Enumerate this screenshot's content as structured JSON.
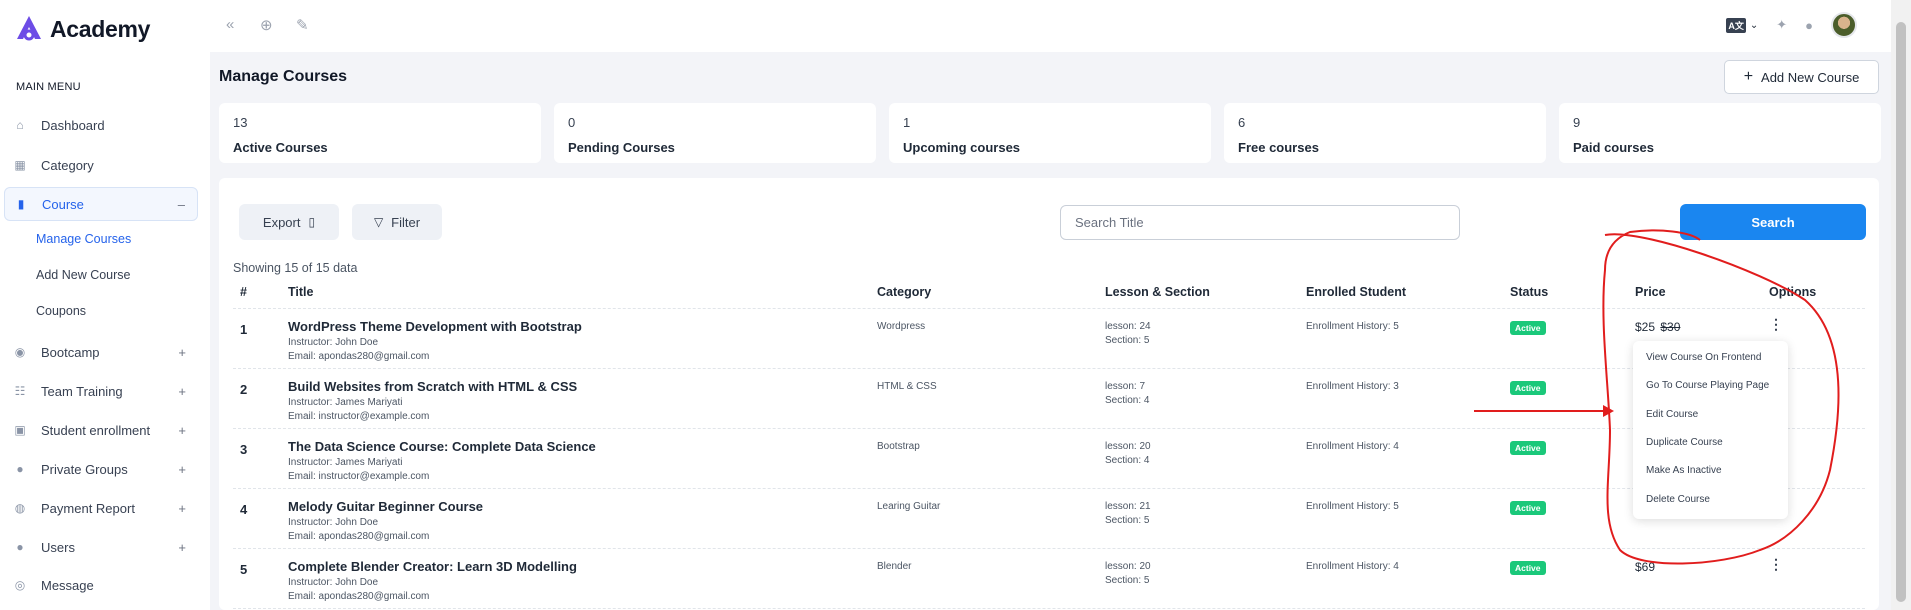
{
  "app": {
    "name": "Academy"
  },
  "sidebar": {
    "heading": "MAIN MENU",
    "items": [
      {
        "label": "Dashboard",
        "icon": "home-icon",
        "toggle": ""
      },
      {
        "label": "Category",
        "icon": "grid-icon",
        "toggle": ""
      },
      {
        "label": "Course",
        "icon": "book-icon",
        "toggle": "–"
      },
      {
        "label": "Bootcamp",
        "icon": "broadcast-icon",
        "toggle": "+"
      },
      {
        "label": "Team Training",
        "icon": "team-icon",
        "toggle": "+"
      },
      {
        "label": "Student enrollment",
        "icon": "id-card-icon",
        "toggle": "+"
      },
      {
        "label": "Private Groups",
        "icon": "group-icon",
        "toggle": "+"
      },
      {
        "label": "Payment Report",
        "icon": "payment-icon",
        "toggle": "+"
      },
      {
        "label": "Users",
        "icon": "users-icon",
        "toggle": "+"
      },
      {
        "label": "Message",
        "icon": "message-icon",
        "toggle": ""
      }
    ],
    "course_sub": [
      "Manage Courses",
      "Add New Course",
      "Coupons"
    ]
  },
  "header": {
    "page_title": "Manage Courses",
    "add_button": "Add New Course",
    "lang_label": "A文"
  },
  "stats": [
    {
      "value": "13",
      "label": "Active Courses"
    },
    {
      "value": "0",
      "label": "Pending Courses"
    },
    {
      "value": "1",
      "label": "Upcoming courses"
    },
    {
      "value": "6",
      "label": "Free courses"
    },
    {
      "value": "9",
      "label": "Paid courses"
    }
  ],
  "toolbar": {
    "export": "Export",
    "filter": "Filter",
    "search_placeholder": "Search Title",
    "search_button": "Search",
    "showing": "Showing 15 of 15 data"
  },
  "table": {
    "headers": [
      "#",
      "Title",
      "Category",
      "Lesson & Section",
      "Enrolled Student",
      "Status",
      "Price",
      "Options"
    ],
    "rows": [
      {
        "num": "1",
        "title": "WordPress Theme Development with Bootstrap",
        "instructor": "Instructor: John Doe",
        "email": "Email: apondas280@gmail.com",
        "category": "Wordpress",
        "lesson": "lesson: 24",
        "section": "Section: 5",
        "enrolled": "Enrollment History: 5",
        "status": "Active",
        "price": "$25",
        "old_price": "$30"
      },
      {
        "num": "2",
        "title": "Build Websites from Scratch with HTML & CSS",
        "instructor": "Instructor: James Mariyati",
        "email": "Email: instructor@example.com",
        "category": "HTML & CSS",
        "lesson": "lesson: 7",
        "section": "Section: 4",
        "enrolled": "Enrollment History: 3",
        "status": "Active",
        "price": "",
        "old_price": ""
      },
      {
        "num": "3",
        "title": "The Data Science Course: Complete Data Science",
        "instructor": "Instructor: James Mariyati",
        "email": "Email: instructor@example.com",
        "category": "Bootstrap",
        "lesson": "lesson: 20",
        "section": "Section: 4",
        "enrolled": "Enrollment History: 4",
        "status": "Active",
        "price": "",
        "old_price": ""
      },
      {
        "num": "4",
        "title": "Melody Guitar Beginner Course",
        "instructor": "Instructor: John Doe",
        "email": "Email: apondas280@gmail.com",
        "category": "Learing Guitar",
        "lesson": "lesson: 21",
        "section": "Section: 5",
        "enrolled": "Enrollment History: 5",
        "status": "Active",
        "price": "",
        "old_price": ""
      },
      {
        "num": "5",
        "title": "Complete Blender Creator: Learn 3D Modelling",
        "instructor": "Instructor: John Doe",
        "email": "Email: apondas280@gmail.com",
        "category": "Blender",
        "lesson": "lesson: 20",
        "section": "Section: 5",
        "enrolled": "Enrollment History: 4",
        "status": "Active",
        "price": "$69",
        "old_price": ""
      }
    ]
  },
  "options_menu": [
    "View Course On Frontend",
    "Go To Course Playing Page",
    "Edit Course",
    "Duplicate Course",
    "Make As Inactive",
    "Delete Course"
  ],
  "colors": {
    "accent": "#1a86f0",
    "active_badge": "#1ac87a",
    "annotation": "#e11d1d",
    "logo": "#6d4ce6"
  }
}
